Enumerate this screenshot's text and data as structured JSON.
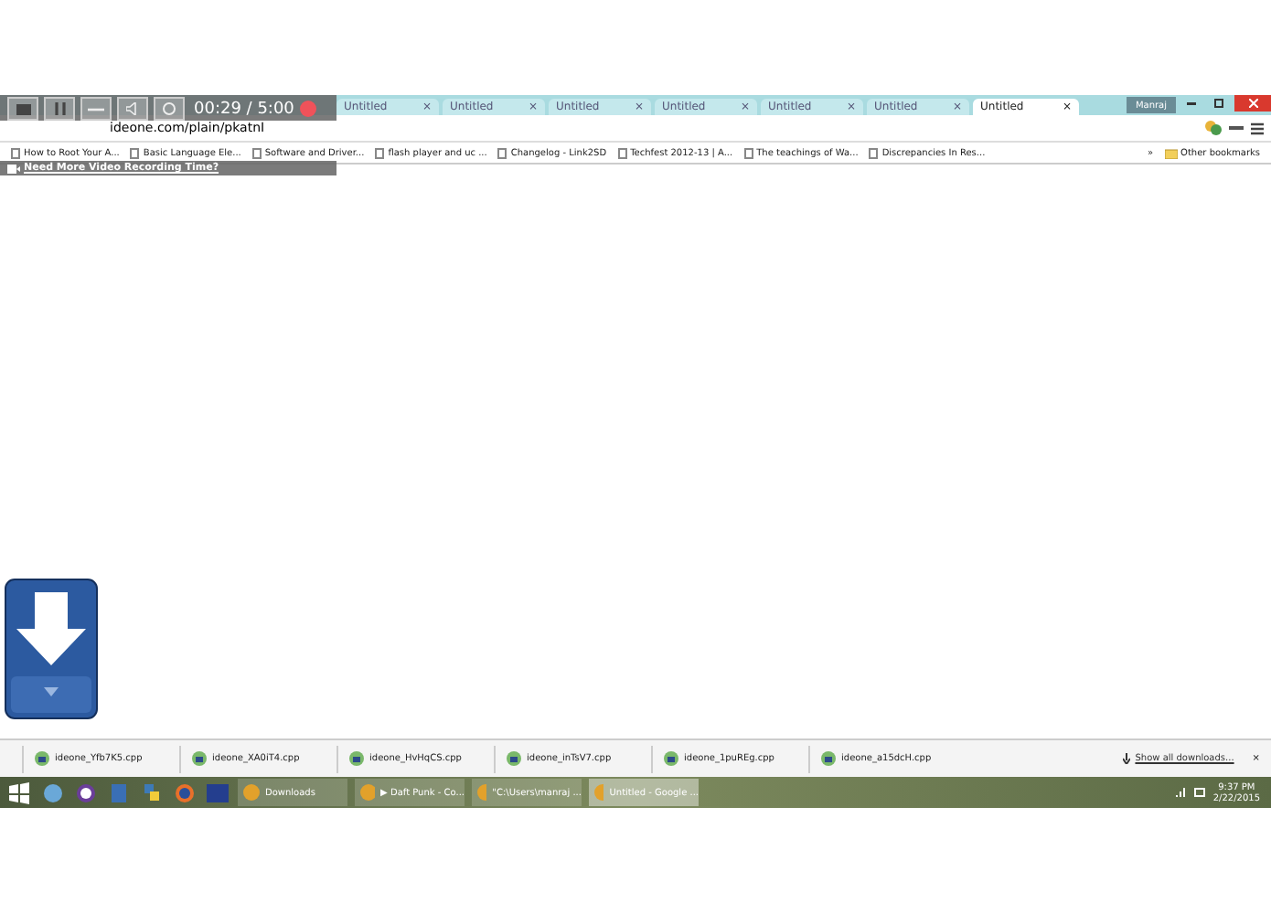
{
  "recorder": {
    "timer": "00:29 / 5:00",
    "recording": true,
    "promo": "Need More Video Recording Time?"
  },
  "tabs": [
    {
      "label": "Untitled",
      "close": "×",
      "selected": false
    },
    {
      "label": "Untitled",
      "close": "×",
      "selected": false
    },
    {
      "label": "Untitled",
      "close": "×",
      "selected": false
    },
    {
      "label": "Untitled",
      "close": "×",
      "selected": false
    },
    {
      "label": "Untitled",
      "close": "×",
      "selected": false
    },
    {
      "label": "Untitled",
      "close": "×",
      "selected": false
    },
    {
      "label": "Untitled",
      "close": "×",
      "selected": true
    }
  ],
  "profile": "Manraj",
  "address": "ideone.com/plain/pkatnI",
  "bookmarks": [
    "How to Root Your A...",
    "Basic Language Ele...",
    "Software and Driver...",
    "flash player and uc ...",
    "Changelog - Link2SD",
    "Techfest 2012-13 | A...",
    "The teachings of Wa...",
    "Discrepancies In Res..."
  ],
  "bookmarks_more": "»",
  "other_bookmarks": "Other bookmarks",
  "downloads": [
    "ideone_Yfb7K5.cpp",
    "ideone_XA0iT4.cpp",
    "ideone_HvHqCS.cpp",
    "ideone_inTsV7.cpp",
    "ideone_1puREg.cpp",
    "ideone_a15dcH.cpp"
  ],
  "show_all": "Show all downloads...",
  "downloads_close": "×",
  "taskbar": {
    "tasks": [
      {
        "label": "Downloads",
        "selected": false
      },
      {
        "label": "▶ Daft Punk - Co...",
        "selected": false
      },
      {
        "label": "\"C:\\Users\\manraj ...",
        "selected": false
      },
      {
        "label": "Untitled - Google ...",
        "selected": true
      }
    ],
    "time": "9:37 PM",
    "date": "2/22/2015"
  }
}
